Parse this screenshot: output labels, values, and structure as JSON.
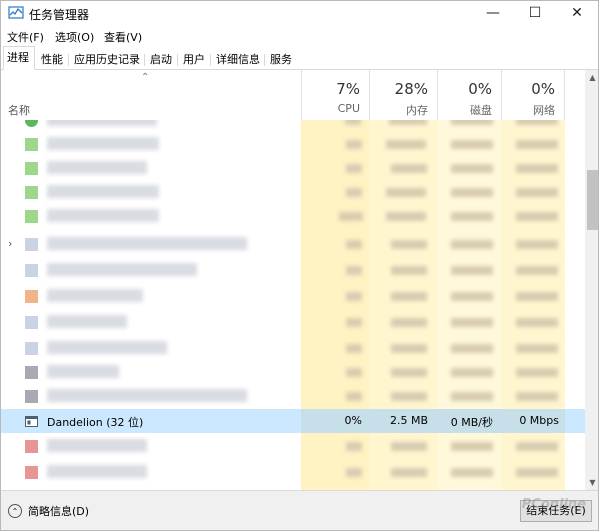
{
  "window": {
    "title": "任务管理器"
  },
  "menu": [
    "文件(F)",
    "选项(O)",
    "查看(V)"
  ],
  "tabs": [
    "进程",
    "性能",
    "应用历史记录",
    "启动",
    "用户",
    "详细信息",
    "服务"
  ],
  "columns": {
    "name": "名称",
    "cpu": {
      "pct": "7%",
      "label": "CPU"
    },
    "mem": {
      "pct": "28%",
      "label": "内存"
    },
    "disk": {
      "pct": "0%",
      "label": "磁盘"
    },
    "net": {
      "pct": "0%",
      "label": "网络"
    }
  },
  "selected_row": {
    "name": "Dandelion (32 位)",
    "cpu": "0%",
    "mem": "2.5 MB",
    "disk": "0 MB/秒",
    "net": "0 Mbps"
  },
  "footer": {
    "fewer_details": "简略信息(D)",
    "end_task": "结束任务(E)"
  },
  "watermark": "PConline",
  "colors": {
    "selection": "#cce8ff",
    "heat_column": "#fff6cf"
  }
}
